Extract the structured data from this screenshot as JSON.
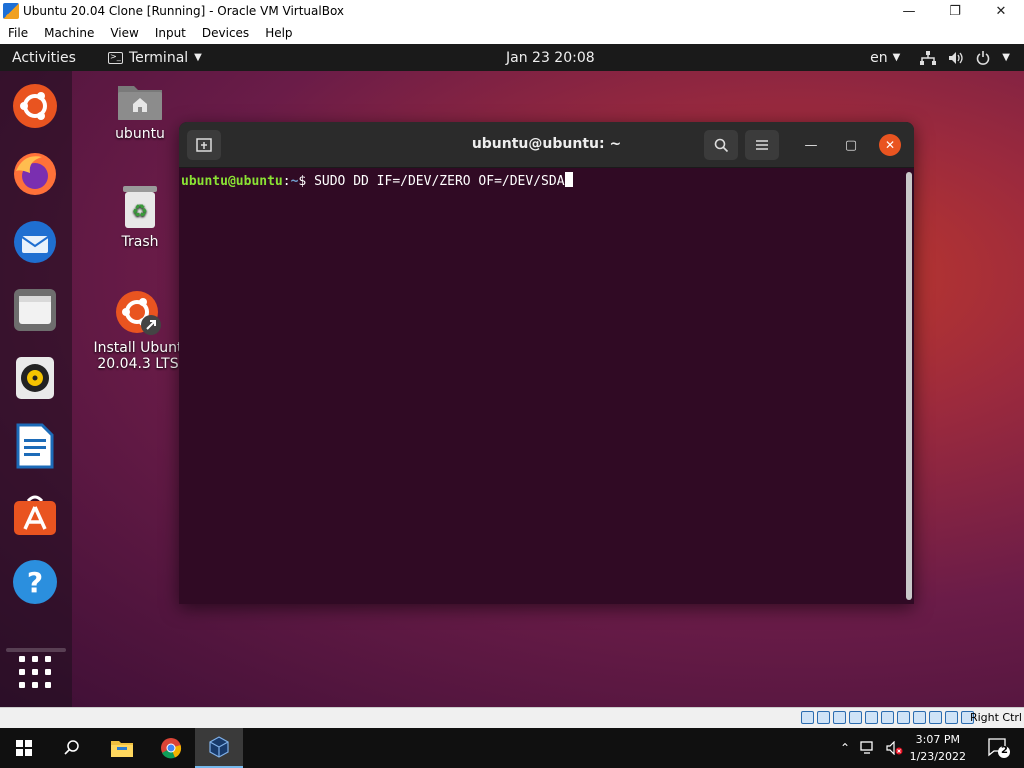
{
  "vbox": {
    "title": "Ubuntu 20.04 Clone [Running] - Oracle VM VirtualBox",
    "menu": [
      "File",
      "Machine",
      "View",
      "Input",
      "Devices",
      "Help"
    ],
    "host_key": "Right Ctrl"
  },
  "gnome": {
    "activities": "Activities",
    "app_menu": "Terminal",
    "clock": "Jan 23  20:08",
    "lang": "en"
  },
  "desktop": {
    "home_label": "ubuntu",
    "trash_label": "Trash",
    "install_label_1": "Install Ubunt",
    "install_label_2": "20.04.3 LTS"
  },
  "terminal": {
    "title": "ubuntu@ubuntu: ~",
    "prompt_user": "ubuntu@ubuntu",
    "prompt_sep": ":",
    "prompt_path": "~",
    "prompt_symbol": "$ ",
    "command": "SUDO DD IF=/DEV/ZERO OF=/DEV/SDA"
  },
  "taskbar": {
    "time": "3:07 PM",
    "date": "1/23/2022",
    "notifications": "2"
  },
  "colors": {
    "ubuntu_orange": "#e95420",
    "prompt_green": "#8ae234",
    "prompt_blue": "#729fcf",
    "terminal_bg": "#300a24"
  }
}
